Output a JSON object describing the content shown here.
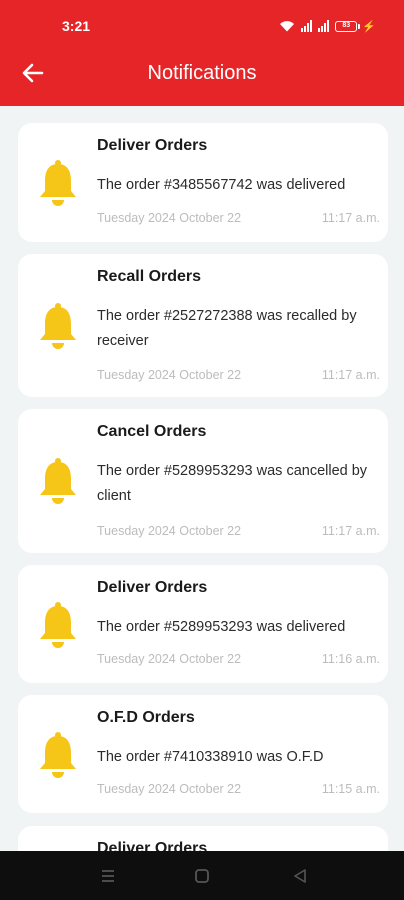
{
  "status_bar": {
    "time": "3:21",
    "battery": "83"
  },
  "header": {
    "title": "Notifications"
  },
  "colors": {
    "accent": "#e52528",
    "bell": "#f5c518",
    "background": "#f1f4f4"
  },
  "notifications": [
    {
      "title": "Deliver Orders",
      "message": "The order #3485567742 was delivered",
      "date": "Tuesday 2024 October 22",
      "time": "11:17 a.m."
    },
    {
      "title": "Recall Orders",
      "message": "The order #2527272388 was recalled by receiver",
      "date": "Tuesday 2024 October 22",
      "time": "11:17 a.m."
    },
    {
      "title": "Cancel Orders",
      "message": "The order #5289953293 was cancelled by client",
      "date": "Tuesday 2024 October 22",
      "time": "11:17 a.m."
    },
    {
      "title": "Deliver Orders",
      "message": "The order #5289953293 was delivered",
      "date": "Tuesday 2024 October 22",
      "time": "11:16 a.m."
    },
    {
      "title": "O.F.D Orders",
      "message": "The order #7410338910 was O.F.D",
      "date": "Tuesday 2024 October 22",
      "time": "11:15 a.m."
    },
    {
      "title": "Deliver Orders"
    }
  ]
}
